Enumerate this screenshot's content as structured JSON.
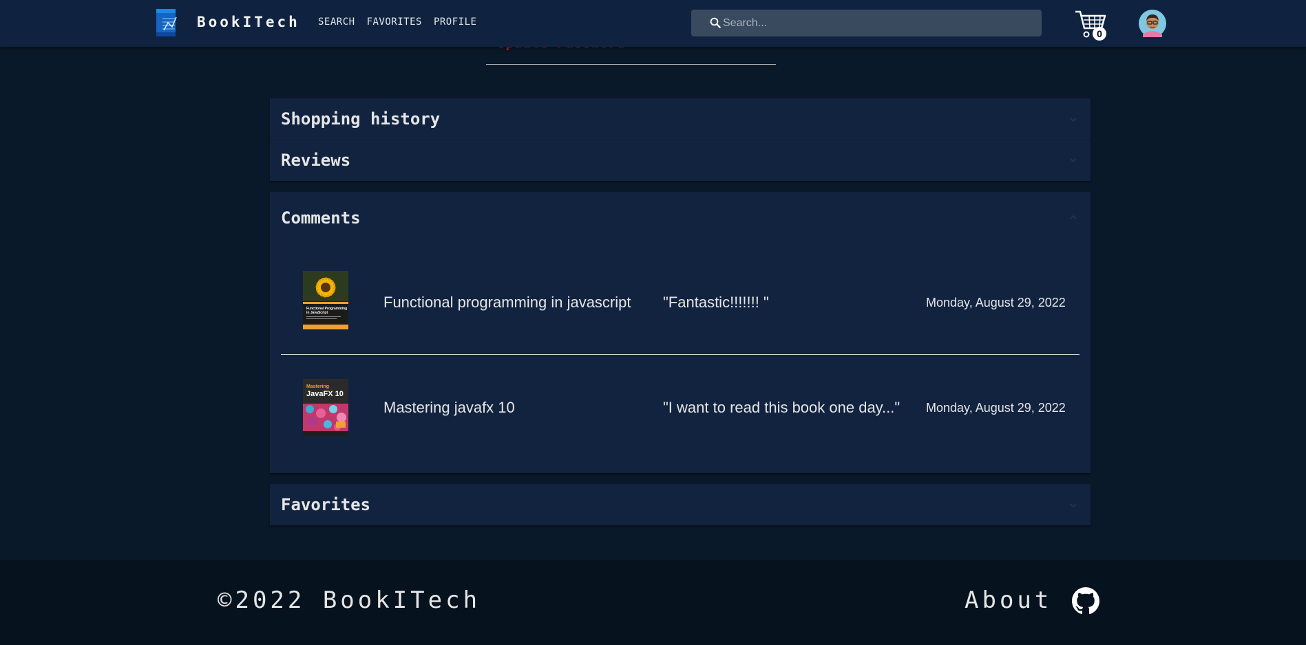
{
  "header": {
    "brand": "BookITech",
    "nav": [
      "SEARCH",
      "FAVORITES",
      "PROFILE"
    ],
    "search_placeholder": "Search...",
    "cart_count": "0"
  },
  "profile": {
    "update_password_label": "Update Password"
  },
  "sections": {
    "shopping_history": {
      "title": "Shopping history",
      "expanded": false
    },
    "reviews": {
      "title": "Reviews",
      "expanded": false
    },
    "comments": {
      "title": "Comments",
      "expanded": true,
      "items": [
        {
          "book_title": "Functional programming in javascript",
          "comment": "\"Fantastic!!!!!!! \"",
          "date": "Monday, August 29, 2022",
          "cover": {
            "style": "sunflower",
            "caption": "Functional Programming in JavaScript"
          }
        },
        {
          "book_title": "Mastering javafx 10",
          "comment": "\"I want to read this book one day...\"",
          "date": "Monday, August 29, 2022",
          "cover": {
            "style": "javafx",
            "caption_small": "Mastering",
            "caption_large": "JavaFX 10"
          }
        }
      ]
    },
    "favorites": {
      "title": "Favorites",
      "expanded": false
    }
  },
  "footer": {
    "copyright": "©2022 BookITech",
    "about": "About"
  },
  "colors": {
    "background": "#0a1929",
    "header": "#0f2340",
    "panel": "#11233f",
    "footer": "#07121f",
    "danger": "#cc1a1a",
    "search": "#3a4a5e"
  }
}
